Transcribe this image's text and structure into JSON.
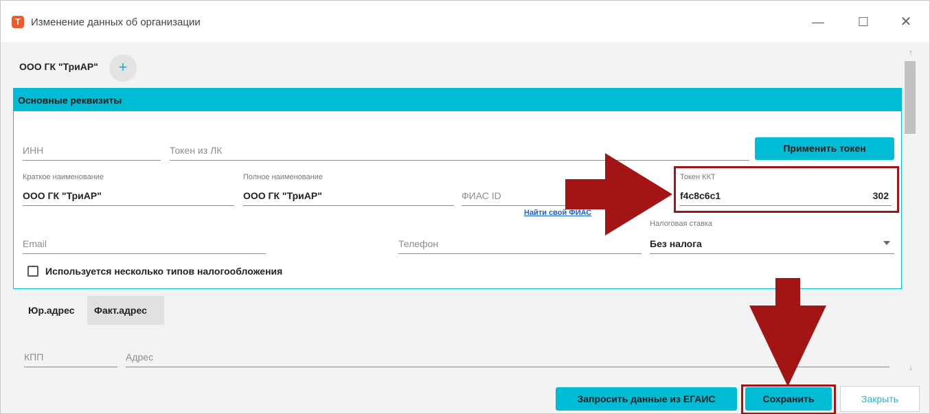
{
  "window": {
    "app_icon_letter": "T",
    "title": "Изменение данных об организации",
    "minimize_glyph": "—",
    "maximize_glyph": "☐",
    "close_glyph": "✕"
  },
  "org": {
    "name": "ООО ГК \"ТриАР\"",
    "add_glyph": "+"
  },
  "section": {
    "title": "Основные реквизиты"
  },
  "fields": {
    "inn_placeholder": "ИНН",
    "lk_token_placeholder": "Токен из ЛК",
    "apply_token_label": "Применить токен",
    "short_name_label": "Краткое наименование",
    "short_name_value": "ООО ГК \"ТриАР\"",
    "full_name_label": "Полное наименование",
    "full_name_value": "ООО ГК \"ТриАР\"",
    "fias_placeholder": "ФИАС ID",
    "find_fias_link": "Найти свой ФИАС",
    "kkt_token_label": "Токен ККТ",
    "kkt_token_value_start": "f4c8c6c1",
    "kkt_token_value_end": "302",
    "tax_rate_label": "Налоговая ставка",
    "tax_rate_value": "Без налога",
    "email_placeholder": "Email",
    "phone_placeholder": "Телефон",
    "multi_tax_label": "Используется несколько типов налогообложения",
    "multi_tax_checked": false
  },
  "address_tabs": {
    "jur": "Юр.адрес",
    "fact": "Факт.адрес",
    "active": "fact"
  },
  "address_fields": {
    "kpp_placeholder": "КПП",
    "address_placeholder": "Адрес"
  },
  "scroll": {
    "up_glyph": "↑",
    "down_glyph": "↓"
  },
  "footer": {
    "egais_button": "Запросить данные из ЕГАИС",
    "save_button": "Сохранить",
    "close_button": "Закрыть"
  },
  "annotations": {
    "highlight_color": "#a31515",
    "arrow_color": "#a31515"
  },
  "colors": {
    "accent": "#00bcd4",
    "app_icon": "#f05a28",
    "link": "#1a5fd0"
  }
}
